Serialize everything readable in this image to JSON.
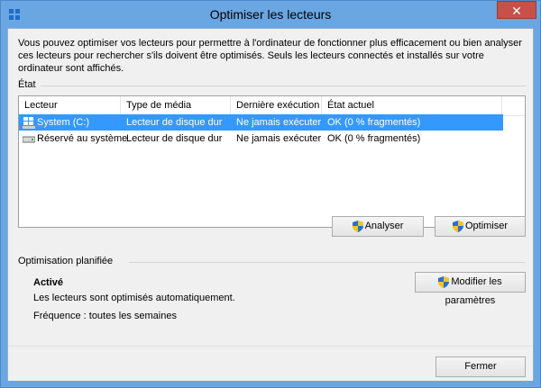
{
  "window": {
    "title": "Optimiser les lecteurs",
    "close_glyph": "✕"
  },
  "intro": "Vous pouvez optimiser vos lecteurs pour permettre à l'ordinateur de fonctionner plus efficacement ou bien analyser ces lecteurs pour rechercher s'ils doivent être optimisés. Seuls les lecteurs connectés et installés sur votre ordinateur sont affichés.",
  "status_section": {
    "label": "État",
    "columns": [
      "Lecteur",
      "Type de média",
      "Dernière exécution",
      "État actuel"
    ],
    "rows": [
      {
        "drive": "System (C:)",
        "media": "Lecteur de disque dur",
        "last_run": "Ne jamais exécuter",
        "state": "OK (0 % fragmentés)",
        "selected": true,
        "icon": "windows-drive-icon"
      },
      {
        "drive": "Réservé au système",
        "media": "Lecteur de disque dur",
        "last_run": "Ne jamais exécuter",
        "state": "OK (0 % fragmentés)",
        "selected": false,
        "icon": "hard-drive-icon"
      }
    ],
    "analyze_label": "Analyser",
    "optimize_label": "Optimiser"
  },
  "scheduled": {
    "label": "Optimisation planifiée",
    "status": "Activé",
    "description": "Les lecteurs sont optimisés automatiquement.",
    "frequency": "Fréquence : toutes les semaines",
    "change_settings_label": "Modifier les paramètres"
  },
  "footer": {
    "close_label": "Fermer"
  },
  "colors": {
    "titlebar": "#6aa6e2",
    "selection": "#3399ff",
    "close_button": "#c7504a"
  }
}
